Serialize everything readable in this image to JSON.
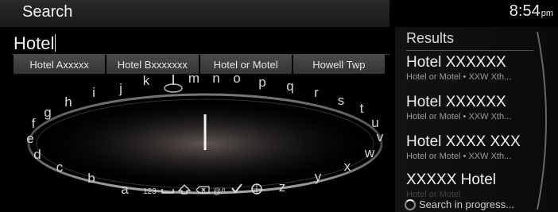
{
  "header": {
    "title": "Search",
    "time": "8:54",
    "ampm": "pm"
  },
  "query": {
    "value": "Hotel"
  },
  "suggestions": [
    "Hotel Axxxxx",
    "Hotel Bxxxxxxx",
    "Hotel or Motel",
    "Howell Twp"
  ],
  "keyboard": {
    "letters": [
      "a",
      "b",
      "c",
      "d",
      "e",
      "f",
      "g",
      "h",
      "i",
      "j",
      "k",
      "l",
      "m",
      "n",
      "o",
      "p",
      "q",
      "r",
      "s",
      "t",
      "u",
      "v",
      "w",
      "x",
      "y",
      "z"
    ],
    "selected": "l",
    "special_keys": [
      "123",
      "space-icon",
      "shift-icon",
      "backspace-icon",
      "@/!",
      "check-icon",
      "globe-icon"
    ],
    "numbers_label": "123",
    "symbols_label": "@/!"
  },
  "results": {
    "title": "Results",
    "items": [
      {
        "name": "Hotel XXXXXX",
        "category": "Hotel or Motel",
        "bullet": "•",
        "detail": "XXW Xth..."
      },
      {
        "name": "Hotel XXXXXX",
        "category": "Hotel or Motel",
        "bullet": "•",
        "detail": "XXW Xth..."
      },
      {
        "name": "Hotel XXXX XXX",
        "category": "Hotel or Motel",
        "bullet": "•",
        "detail": "XXW Xth..."
      },
      {
        "name": "XXXXX  Hotel",
        "category": "Hotel or Motel",
        "bullet": "",
        "detail": ""
      }
    ],
    "progress": "Search in progress..."
  }
}
